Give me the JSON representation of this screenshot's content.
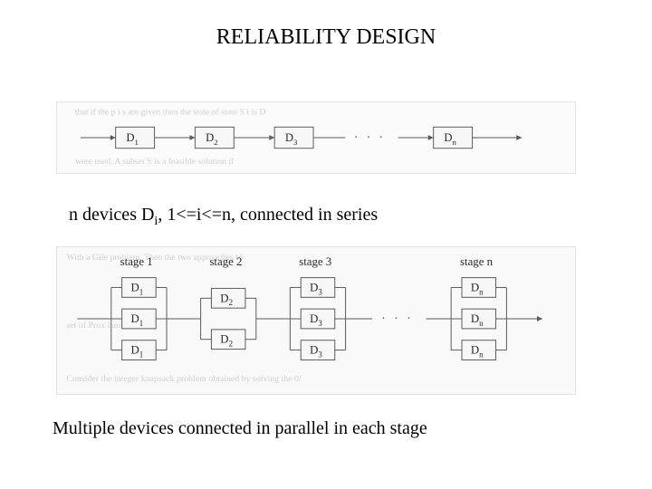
{
  "title": "RELIABILITY DESIGN",
  "caption1_pre": "n devices D",
  "caption1_sub": "i",
  "caption1_post": ", 1<=i<=n, connected in series",
  "caption2": "Multiple devices connected in parallel in each stage",
  "fig1": {
    "devices": [
      {
        "label": "D",
        "sub": "1"
      },
      {
        "label": "D",
        "sub": "2"
      },
      {
        "label": "D",
        "sub": "3"
      },
      {
        "label": "D",
        "sub": "n"
      }
    ]
  },
  "fig2": {
    "stage_labels": [
      "stage 1",
      "stage 2",
      "stage 3",
      "stage n"
    ],
    "col1": [
      {
        "label": "D",
        "sub": "1"
      },
      {
        "label": "D",
        "sub": "1"
      },
      {
        "label": "D",
        "sub": "1"
      }
    ],
    "col2": [
      {
        "label": "D",
        "sub": "2"
      },
      {
        "label": "D",
        "sub": "2"
      }
    ],
    "col3": [
      {
        "label": "D",
        "sub": "3"
      },
      {
        "label": "D",
        "sub": "3"
      },
      {
        "label": "D",
        "sub": "3"
      }
    ],
    "col4": [
      {
        "label": "D",
        "sub": "n"
      },
      {
        "label": "D",
        "sub": "n"
      },
      {
        "label": "D",
        "sub": "n"
      }
    ]
  }
}
